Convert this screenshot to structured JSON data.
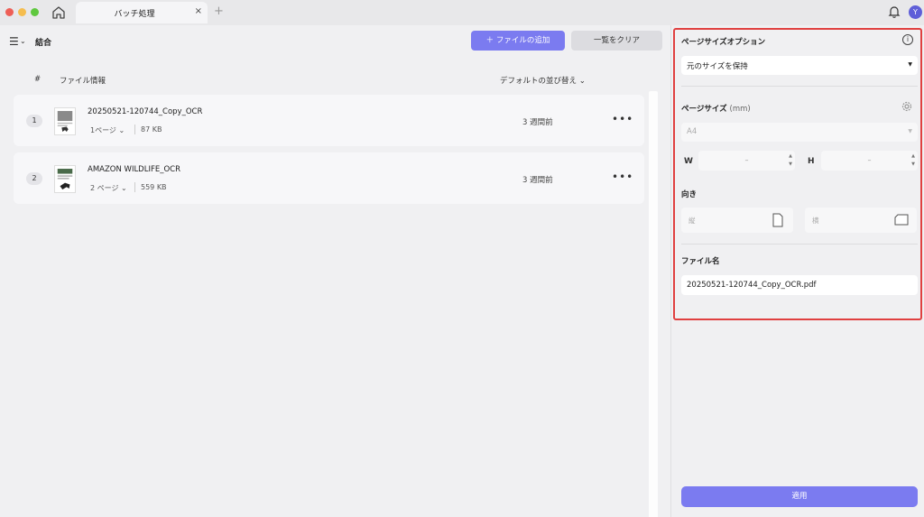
{
  "titlebar": {
    "tab_label": "バッチ処理",
    "tab_close": "×",
    "tab_add": "+",
    "avatar_initial": "Y",
    "traffic_colors": [
      "#ee5f57",
      "#f5bd4f",
      "#5fc83f"
    ]
  },
  "toolbar": {
    "menu_glyph": "☰",
    "menu_chevron": "⌄",
    "section_title": "結合",
    "add_files_label": "＋  ファイルの追加",
    "clear_list_label": "一覧をクリア"
  },
  "list": {
    "col_number": "#",
    "col_file_info": "ファイル情報",
    "sort_label": "デフォルトの並び替え  ⌄",
    "files": [
      {
        "number": "1",
        "name": "20250521-120744_Copy_OCR",
        "pages": "1ページ  ⌄",
        "size": "87 KB",
        "time": "3 週間前",
        "more": "•••"
      },
      {
        "number": "2",
        "name": "AMAZON WILDLIFE_OCR",
        "pages": "2 ページ  ⌄",
        "size": "559 KB",
        "time": "3 週間前",
        "more": "•••"
      }
    ]
  },
  "panel": {
    "page_size_options_label": "ページサイズオプション",
    "info_glyph": "i",
    "size_option_value": "元のサイズを保持",
    "dropdown_arrow": "▼",
    "page_size_label": "ページサイズ",
    "page_size_unit": "(mm)",
    "paper_value": "A4",
    "width_label": "W",
    "height_label": "H",
    "width_value": "–",
    "height_value": "–",
    "stepper_up": "▲",
    "stepper_down": "▼",
    "orientation_label": "向き",
    "portrait_label": "縦",
    "landscape_label": "横",
    "filename_label": "ファイル名",
    "filename_value": "20250521-120744_Copy_OCR.pdf",
    "apply_label": "適用"
  },
  "colors": {
    "accent": "#7b7bf0",
    "highlight_border": "#e04040",
    "avatar": "#5f5fd8"
  }
}
